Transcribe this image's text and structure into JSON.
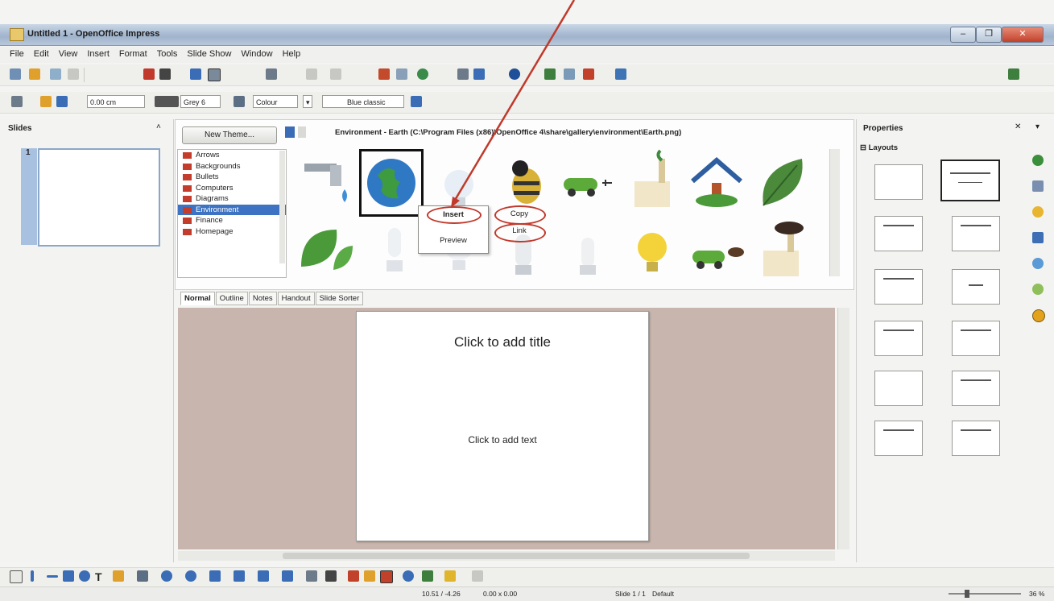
{
  "window": {
    "title": "Untitled 1 - OpenOffice Impress",
    "minimize": "–",
    "restore": "❐",
    "close": "✕"
  },
  "menu": [
    "File",
    "Edit",
    "View",
    "Insert",
    "Format",
    "Tools",
    "Slide Show",
    "Window",
    "Help"
  ],
  "line_toolbar": {
    "width_value": "0.00 cm",
    "line_color": "Grey 6",
    "area_style": "Colour",
    "area_color": "Blue classic"
  },
  "slides_panel": {
    "title": "Slides",
    "slide_number": "1"
  },
  "gallery": {
    "new_theme": "New Theme...",
    "path": "Environment - Earth (C:\\Program Files (x86)\\OpenOffice 4\\share\\gallery\\environment\\Earth.png)",
    "themes": [
      "Arrows",
      "Backgrounds",
      "Bullets",
      "Computers",
      "Diagrams",
      "Environment",
      "Finance",
      "Homepage"
    ],
    "selected_theme": "Environment",
    "items": [
      "faucet-drop-icon",
      "earth-globe-icon",
      "light-bulb-icon",
      "bee-icon",
      "electric-car-icon",
      "factory-icon",
      "green-house-icon",
      "leaf-icon",
      "leaf-icon",
      "cfl-bulb-icon",
      "light-bulb-icon",
      "cfl-bulb-icon",
      "cfl-bulb-icon",
      "glowing-bulb-icon",
      "eco-car-icon",
      "polluting-factory-icon"
    ]
  },
  "context_menu": {
    "insert": "Insert",
    "preview": "Preview",
    "copy": "Copy",
    "link": "Link"
  },
  "view_tabs": [
    "Normal",
    "Outline",
    "Notes",
    "Handout",
    "Slide Sorter"
  ],
  "slide": {
    "title_placeholder": "Click to add title",
    "text_placeholder": "Click to add text"
  },
  "properties": {
    "title": "Properties",
    "section": "Layouts"
  },
  "status": {
    "position": "10.51 / -4.26",
    "size": "0.00 x 0.00",
    "slide": "Slide 1 / 1",
    "master": "Default",
    "zoom": "36 %"
  },
  "colors": {
    "annotation": "#c0392b",
    "selection": "#3d73c2"
  }
}
